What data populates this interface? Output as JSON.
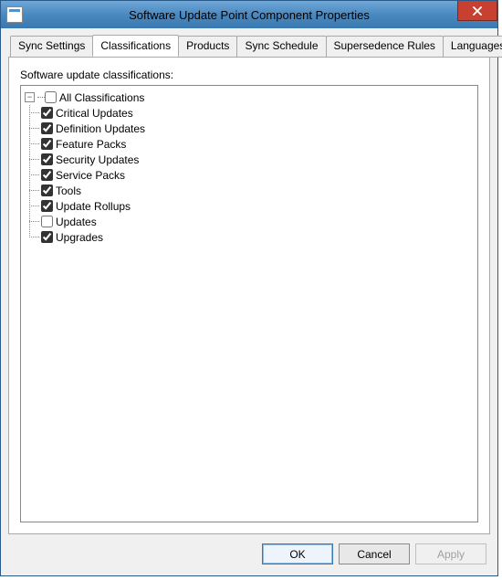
{
  "window": {
    "title": "Software Update Point Component Properties"
  },
  "tabs": [
    {
      "label": "Sync Settings",
      "active": false
    },
    {
      "label": "Classifications",
      "active": true
    },
    {
      "label": "Products",
      "active": false
    },
    {
      "label": "Sync Schedule",
      "active": false
    },
    {
      "label": "Supersedence Rules",
      "active": false
    },
    {
      "label": "Languages",
      "active": false
    }
  ],
  "section_label": "Software update classifications:",
  "tree": {
    "root": {
      "label": "All Classifications",
      "checked": false,
      "expanded": true
    },
    "children": [
      {
        "label": "Critical Updates",
        "checked": true
      },
      {
        "label": "Definition Updates",
        "checked": true
      },
      {
        "label": "Feature Packs",
        "checked": true
      },
      {
        "label": "Security Updates",
        "checked": true
      },
      {
        "label": "Service Packs",
        "checked": true
      },
      {
        "label": "Tools",
        "checked": true
      },
      {
        "label": "Update Rollups",
        "checked": true
      },
      {
        "label": "Updates",
        "checked": false
      },
      {
        "label": "Upgrades",
        "checked": true
      }
    ]
  },
  "buttons": {
    "ok": "OK",
    "cancel": "Cancel",
    "apply": "Apply"
  }
}
